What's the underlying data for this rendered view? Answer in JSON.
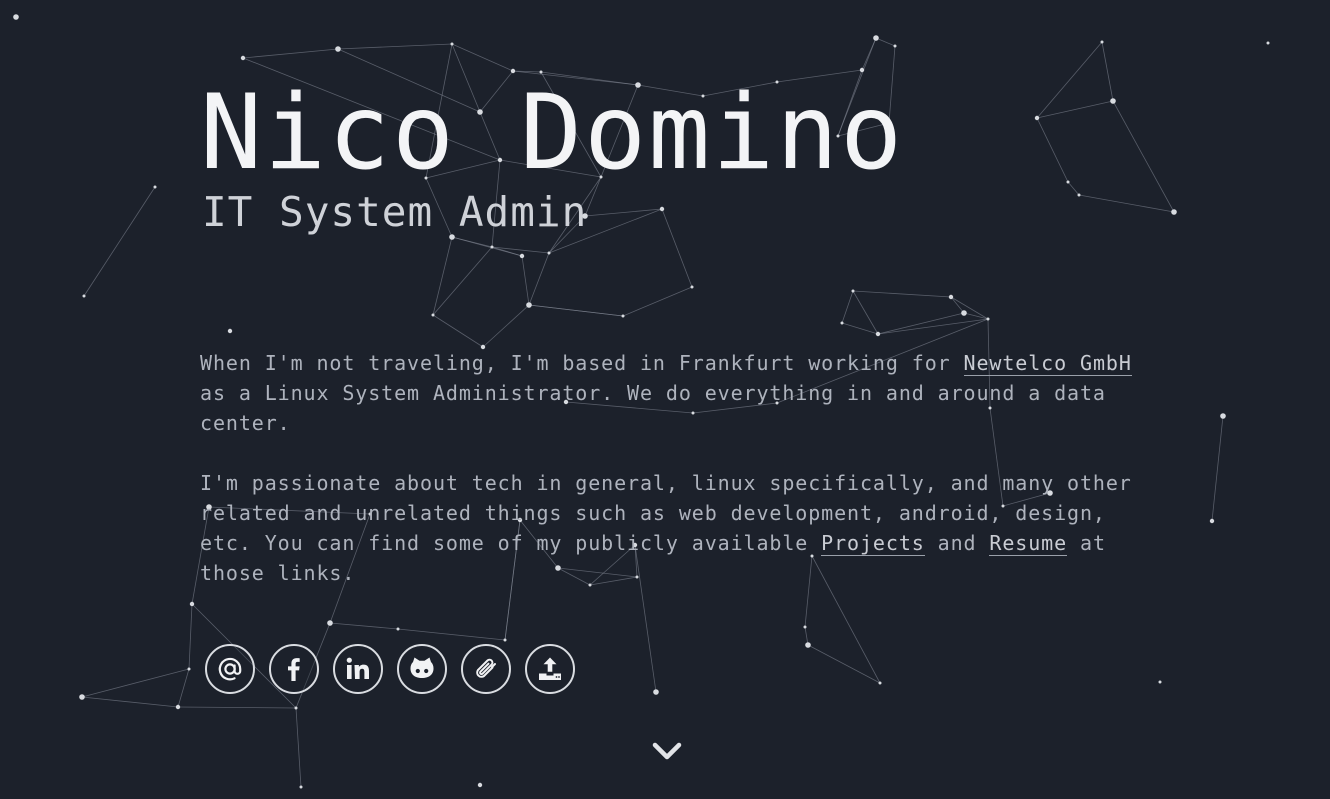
{
  "hero": {
    "name": "Nico Domino",
    "role": "IT System Admin"
  },
  "bio": {
    "p1_before": "When I'm not traveling, I'm based in Frankfurt working for ",
    "p1_link": "Newtelco GmbH",
    "p1_after": " as a Linux System Administrator. We do everything in and around a data center.",
    "p2_before": "I'm passionate about tech in general, linux specifically, and many other related and unrelated things such as web development, android, design, etc. You can find some of my publicly available ",
    "p2_link1": "Projects",
    "p2_mid": " and ",
    "p2_link2": "Resume",
    "p2_after": " at those links."
  },
  "socials": [
    {
      "name": "email",
      "icon": "at-icon"
    },
    {
      "name": "facebook",
      "icon": "facebook-icon"
    },
    {
      "name": "linkedin",
      "icon": "linkedin-icon"
    },
    {
      "name": "github",
      "icon": "github-icon"
    },
    {
      "name": "attachment",
      "icon": "paperclip-icon"
    },
    {
      "name": "upload",
      "icon": "upload-icon"
    }
  ],
  "scroll": {
    "icon": "chevron-down-icon"
  },
  "colors": {
    "background": "#1c212b",
    "text": "#e4e6ea",
    "network_line": "#8a909c",
    "network_dot": "#d8dbe0"
  }
}
